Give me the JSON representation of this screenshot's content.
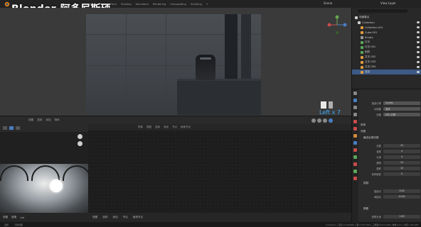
{
  "watermark": "Blender-阿多尼斯硕",
  "topbar": {
    "menus": [
      "UV Editing",
      "Texture Paint",
      "Shading",
      "Animation",
      "Rendering",
      "Compositing",
      "Scripting",
      "+"
    ],
    "scene": "Scene",
    "view_layer": "View Layer"
  },
  "viewport": {
    "view_label": "Left x 7"
  },
  "viewport_header": {
    "menus": [
      "视图",
      "选择",
      "添加",
      "物体"
    ]
  },
  "node_editor_header": {
    "menus": [
      "物体",
      "视图",
      "选择",
      "添加",
      "节点",
      "使用节点"
    ]
  },
  "bottom_left": {
    "items": [
      "视图",
      "图像",
      "hdr"
    ]
  },
  "bottom_tools": {
    "items": [
      "视图",
      "选择",
      "添加",
      "节点",
      "使用节点"
    ]
  },
  "outliner": {
    "title": "场景集合",
    "rows": [
      {
        "label": "Collection",
        "selected": false
      },
      {
        "label": "Collection.001",
        "selected": false
      },
      {
        "label": "Cube.001",
        "selected": false
      },
      {
        "label": "Empty",
        "selected": false
      },
      {
        "label": "灯光",
        "selected": false
      },
      {
        "label": "灯光.001",
        "selected": false
      },
      {
        "label": "相机",
        "selected": false
      },
      {
        "label": "文字.002",
        "selected": false
      },
      {
        "label": "文字.003",
        "selected": false
      },
      {
        "label": "文字.004",
        "selected": false
      },
      {
        "label": "渲染",
        "selected": true
      }
    ]
  },
  "properties": {
    "render_engine_label": "渲染引擎",
    "render_engine": "Cycles",
    "feature_set_label": "功能集",
    "feature_set": "支持",
    "device_label": "设备",
    "device": "GPU 计算",
    "sampling_section": "采样",
    "light_paths_section": "光程",
    "max_bounces_section": "最多反弹次数",
    "bounce_rows": [
      {
        "label": "总数",
        "value": "12"
      },
      {
        "label": "漫射",
        "value": "4"
      },
      {
        "label": "光泽",
        "value": "4"
      },
      {
        "label": "透明",
        "value": "12"
      },
      {
        "label": "透射",
        "value": "12"
      },
      {
        "label": "体积散射",
        "value": "0"
      }
    ],
    "clamp_section": "钳制",
    "clamp_rows": [
      {
        "label": "直接光",
        "value": "0.00"
      },
      {
        "label": "间接光",
        "value": "10.00"
      }
    ],
    "caustics_section": "焦散",
    "filter_label": "滤镜光泽",
    "filter_value": "1.00"
  },
  "statusbar": {
    "left": "选择",
    "mid": "平移视图",
    "stats": "Collection | 顶点:3,336,883 | 面:3,337,030 | 三角面:6,674,038 | 物体:1/11 | 内存:1.84 GiB"
  }
}
